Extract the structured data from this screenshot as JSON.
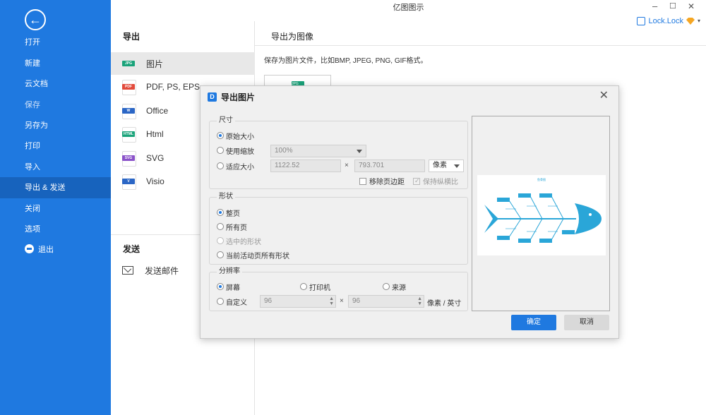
{
  "window": {
    "title": "亿图图示",
    "minimize": "–",
    "maximize": "☐",
    "close": "✕"
  },
  "user": {
    "name": "Lock.Lock"
  },
  "sidebar": {
    "back": "←",
    "items": [
      {
        "label": "打开"
      },
      {
        "label": "新建"
      },
      {
        "label": "云文档"
      },
      {
        "label": "保存"
      },
      {
        "label": "另存为"
      },
      {
        "label": "打印"
      },
      {
        "label": "导入"
      },
      {
        "label": "导出 & 发送"
      },
      {
        "label": "关闭"
      },
      {
        "label": "选项"
      },
      {
        "label": "退出"
      }
    ]
  },
  "export_col": {
    "heading": "导出",
    "formats": [
      {
        "badge": "JPG",
        "label": "图片",
        "color": "#1aa37a"
      },
      {
        "badge": "PDF",
        "label": "PDF, PS, EPS",
        "color": "#e24a3b"
      },
      {
        "badge": "W",
        "label": "Office",
        "color": "#2b66c5"
      },
      {
        "badge": "HTML",
        "label": "Html",
        "color": "#1aa37a"
      },
      {
        "badge": "SVG",
        "label": "SVG",
        "color": "#8a52c9"
      },
      {
        "badge": "V",
        "label": "Visio",
        "color": "#2b66c5"
      }
    ],
    "send_heading": "发送",
    "send_mail": "发送邮件"
  },
  "right_panel": {
    "heading": "导出为图像",
    "desc": "保存为图片文件，比如BMP, JPEG, PNG, GIF格式。",
    "thumb_badge": "JPG"
  },
  "dialog": {
    "title": "导出图片",
    "logo": "D",
    "close": "✕",
    "size": {
      "title": "尺寸",
      "original": "原始大小",
      "use_scale": "使用缩放",
      "scale_value": "100%",
      "fit_size": "适应大小",
      "width": "1122.52",
      "height": "793.701",
      "x": "×",
      "unit": "像素",
      "remove_margin": "移除页边距",
      "keep_ratio": "保持纵横比"
    },
    "shape": {
      "title": "形状",
      "whole_page": "整页",
      "all_pages": "所有页",
      "selected_shapes": "选中的形状",
      "current_page_shapes": "当前活动页所有形状"
    },
    "resolution": {
      "title": "分辨率",
      "screen": "屏幕",
      "printer": "打印机",
      "source": "来源",
      "custom": "自定义",
      "dpi_x": "96",
      "dpi_y": "96",
      "x": "×",
      "unit": "像素 / 英寸"
    },
    "preview_title": "鱼骨图",
    "ok": "确定",
    "cancel": "取消"
  }
}
